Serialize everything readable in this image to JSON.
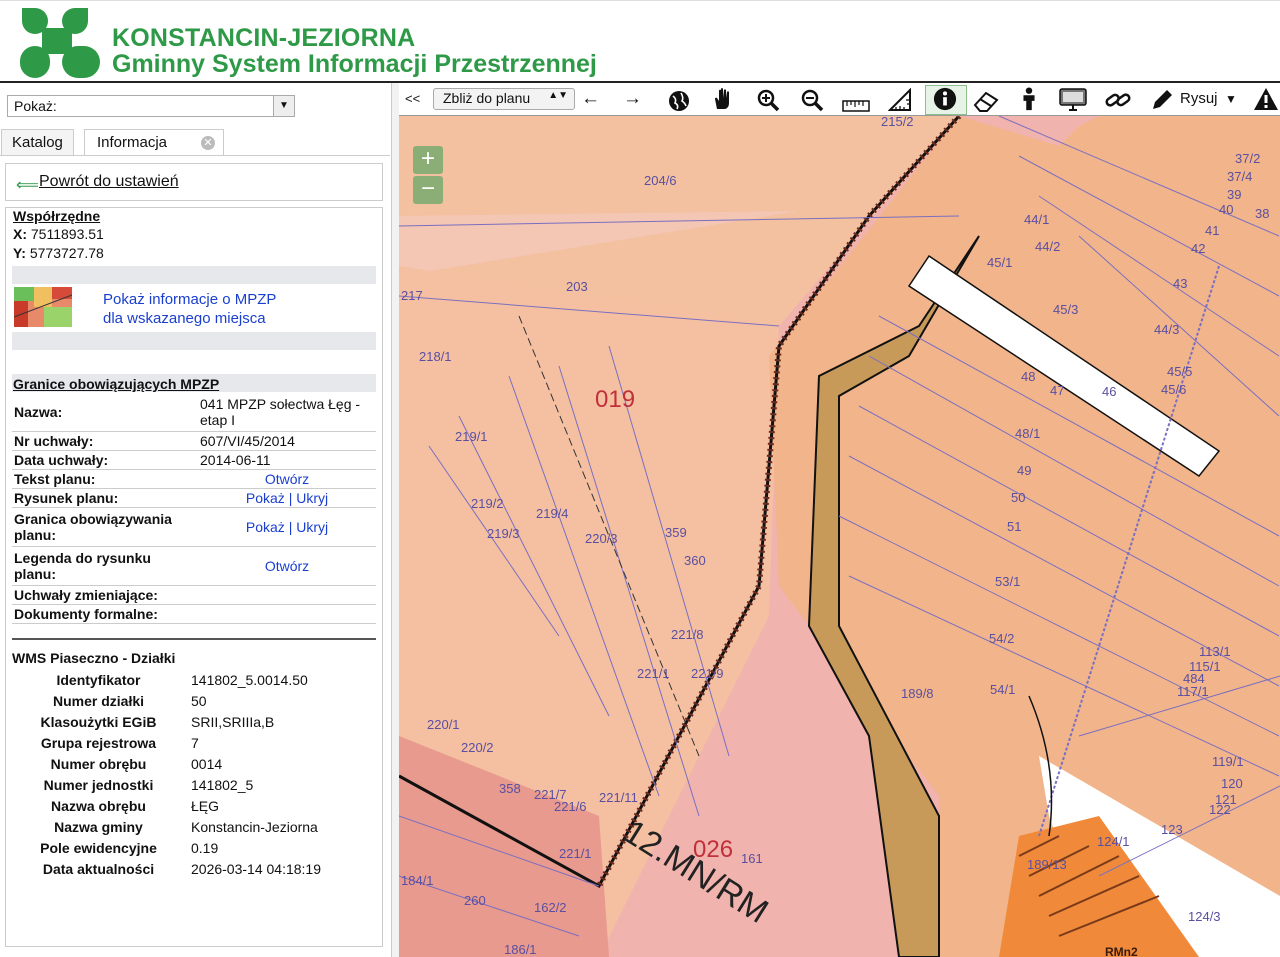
{
  "header": {
    "brand_line1": "KONSTANCIN-JEZIORNA",
    "brand_line2": "Gminny System Informacji Przestrzennej",
    "brand_color": "#2e9a48"
  },
  "left_panel": {
    "show_select": "Pokaż:",
    "tabs": [
      {
        "label": "Katalog"
      },
      {
        "label": "Informacja"
      }
    ],
    "back_link": "Powrót do ustawień",
    "coords": {
      "title": "Współrzędne",
      "x_label": "X:",
      "x_value": "7511893.51",
      "y_label": "Y:",
      "y_value": "5773727.78"
    },
    "mpzp_link_line1": "Pokaż informacje o MPZP",
    "mpzp_link_line2": "dla wskazanego miejsca",
    "granice": {
      "title": "Granice obowiązujących MPZP",
      "rows": [
        {
          "key": "Nazwa:",
          "value": "041 MPZP sołectwa Łęg - etap I"
        },
        {
          "key": "Nr uchwały:",
          "value": "607/VI/45/2014"
        },
        {
          "key": "Data uchwały:",
          "value": "2014-06-11"
        },
        {
          "key": "Tekst planu:",
          "value": "Otwórz"
        },
        {
          "key": "Rysunek planu:",
          "value": "Pokaż | Ukryj"
        },
        {
          "key": "Granica obowiązywania planu:",
          "value": "Pokaż | Ukryj"
        },
        {
          "key": "Legenda do rysunku planu:",
          "value": "Otwórz"
        },
        {
          "key": "Uchwały zmieniające:",
          "value": ""
        },
        {
          "key": "Dokumenty formalne:",
          "value": ""
        }
      ]
    },
    "wms": {
      "title": "WMS Piaseczno - Działki",
      "rows": [
        {
          "key": "Identyfikator",
          "value": "141802_5.0014.50"
        },
        {
          "key": "Numer działki",
          "value": "50"
        },
        {
          "key": "Klasoużytki EGiB",
          "value": "SRII,SRIIIa,B"
        },
        {
          "key": "Grupa rejestrowa",
          "value": "7"
        },
        {
          "key": "Numer obrębu",
          "value": "0014"
        },
        {
          "key": "Numer jednostki",
          "value": "141802_5"
        },
        {
          "key": "Nazwa obrębu",
          "value": "ŁĘG"
        },
        {
          "key": "Nazwa gminy",
          "value": "Konstancin-Jeziorna"
        },
        {
          "key": "Pole ewidencyjne",
          "value": "0.19"
        },
        {
          "key": "Data aktualności",
          "value": "2026-03-14 04:18:19"
        }
      ]
    }
  },
  "toolbar": {
    "collapse": "<<",
    "zoom_select": "Zbliż do planu",
    "draw_label": "Rysuj",
    "icons": [
      "arrow-left-icon",
      "arrow-right-icon",
      "globe-icon",
      "pan-hand-icon",
      "zoom-in-icon",
      "zoom-out-icon",
      "ruler-icon",
      "area-measure-icon",
      "info-icon",
      "eraser-icon",
      "person-icon",
      "screen-icon",
      "link-icon",
      "pencil-icon",
      "warning-icon"
    ]
  },
  "map": {
    "zoom_in": "+",
    "zoom_out": "−",
    "parcel_labels": [
      "215/2",
      "204/6",
      "203",
      "217",
      "218/1",
      "219/1",
      "219/2",
      "219/3",
      "219/4",
      "220/3",
      "359",
      "360",
      "221/8",
      "221/9",
      "221/1",
      "220/1",
      "220/2",
      "358",
      "221/7",
      "221/6",
      "221/11",
      "221/1",
      "184/1",
      "260",
      "162/2",
      "186/1",
      "189/8",
      "019",
      "026",
      "12.MN/RM",
      "161",
      "37/2",
      "37/4",
      "39",
      "40",
      "38",
      "41",
      "42",
      "44/1",
      "44/2",
      "45/1",
      "43",
      "45/3",
      "44/3",
      "45/5",
      "45/6",
      "48",
      "47",
      "46",
      "48/1",
      "49",
      "50",
      "51",
      "53/1",
      "54/2",
      "54/1",
      "113/1",
      "115/1",
      "484",
      "117/1",
      "119/1",
      "120",
      "121",
      "122",
      "123",
      "124/1",
      "124/3",
      "189/13",
      "RMn2"
    ],
    "colors": {
      "zone_pink": "#f1b3ad",
      "zone_orange": "#f2b48a",
      "zone_brown": "#c89a5a",
      "parcel_line": "#7a6fc0"
    }
  }
}
